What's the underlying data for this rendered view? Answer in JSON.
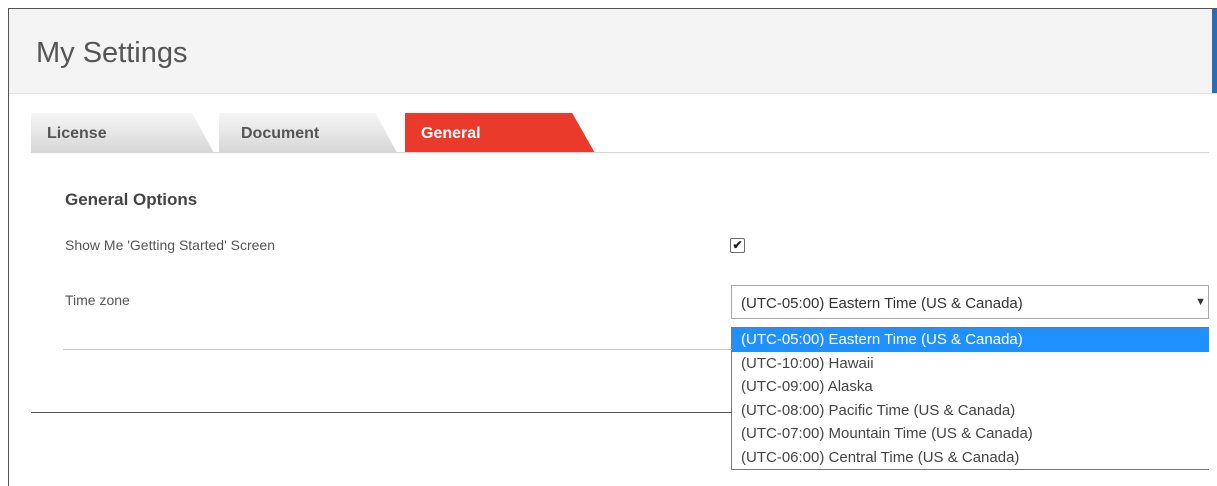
{
  "header": {
    "title": "My Settings",
    "accent_color": "#2a6db4"
  },
  "tabs": [
    {
      "label": "License",
      "active": false
    },
    {
      "label": "Document",
      "active": false
    },
    {
      "label": "General",
      "active": true,
      "color": "#ea3a2b"
    }
  ],
  "general": {
    "section_title": "General Options",
    "getting_started_label": "Show Me 'Getting Started' Screen",
    "getting_started_checked": true,
    "timezone_label": "Time zone",
    "timezone_value": "(UTC-05:00) Eastern Time (US & Canada)",
    "timezone_options": [
      "(UTC-05:00) Eastern Time (US & Canada)",
      "(UTC-10:00) Hawaii",
      "(UTC-09:00) Alaska",
      "(UTC-08:00) Pacific Time (US & Canada)",
      "(UTC-07:00) Mountain Time (US & Canada)",
      "(UTC-06:00) Central Time (US & Canada)"
    ],
    "highlight_color": "#1e90ff"
  }
}
